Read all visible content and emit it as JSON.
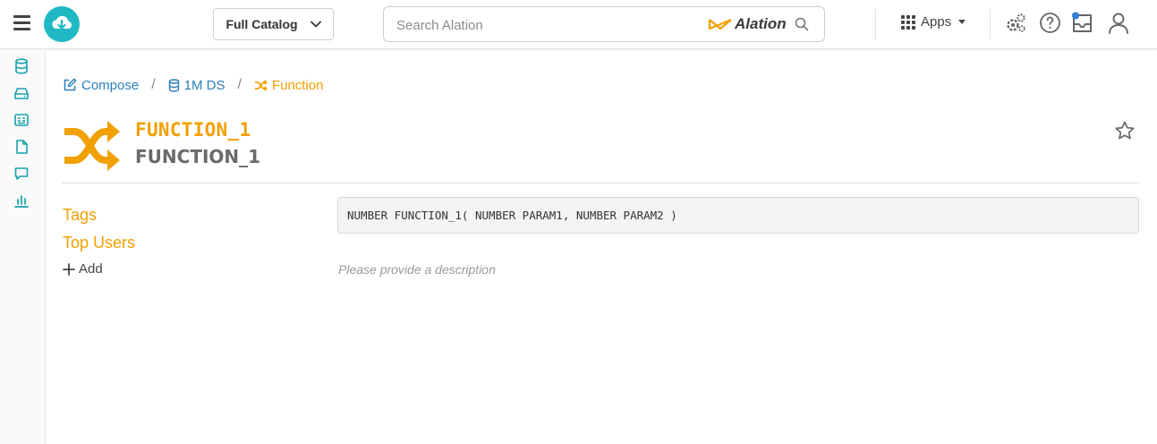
{
  "topbar": {
    "catalog_label": "Full Catalog",
    "search_placeholder": "Search Alation",
    "brand_name": "Alation",
    "apps_label": "Apps"
  },
  "breadcrumb": {
    "items": [
      {
        "label": "Compose",
        "icon": "edit-icon"
      },
      {
        "label": "1M DS",
        "icon": "database-icon"
      },
      {
        "label": "Function",
        "icon": "shuffle-icon"
      }
    ],
    "separator": "/"
  },
  "header": {
    "title": "FUNCTION_1",
    "subtitle": "FUNCTION_1"
  },
  "left_panel": {
    "tags_label": "Tags",
    "top_users_label": "Top Users",
    "add_label": "Add"
  },
  "main": {
    "signature": "NUMBER FUNCTION_1( NUMBER PARAM1, NUMBER PARAM2 )",
    "description_placeholder": "Please provide a description"
  },
  "colors": {
    "accent_orange": "#f1a000",
    "link_blue": "#2a7fbd",
    "teal": "#1fb8c3",
    "notification_blue": "#2f7fd6"
  },
  "icons": [
    "hamburger-icon",
    "cloud-download-icon",
    "chevron-down-icon",
    "search-icon",
    "apps-grid-icon",
    "settings-gears-icon",
    "help-icon",
    "inbox-icon",
    "user-icon",
    "database-icon",
    "drive-icon",
    "article-icon",
    "document-icon",
    "conversation-icon",
    "analytics-icon",
    "shuffle-icon",
    "star-icon",
    "plus-icon"
  ]
}
